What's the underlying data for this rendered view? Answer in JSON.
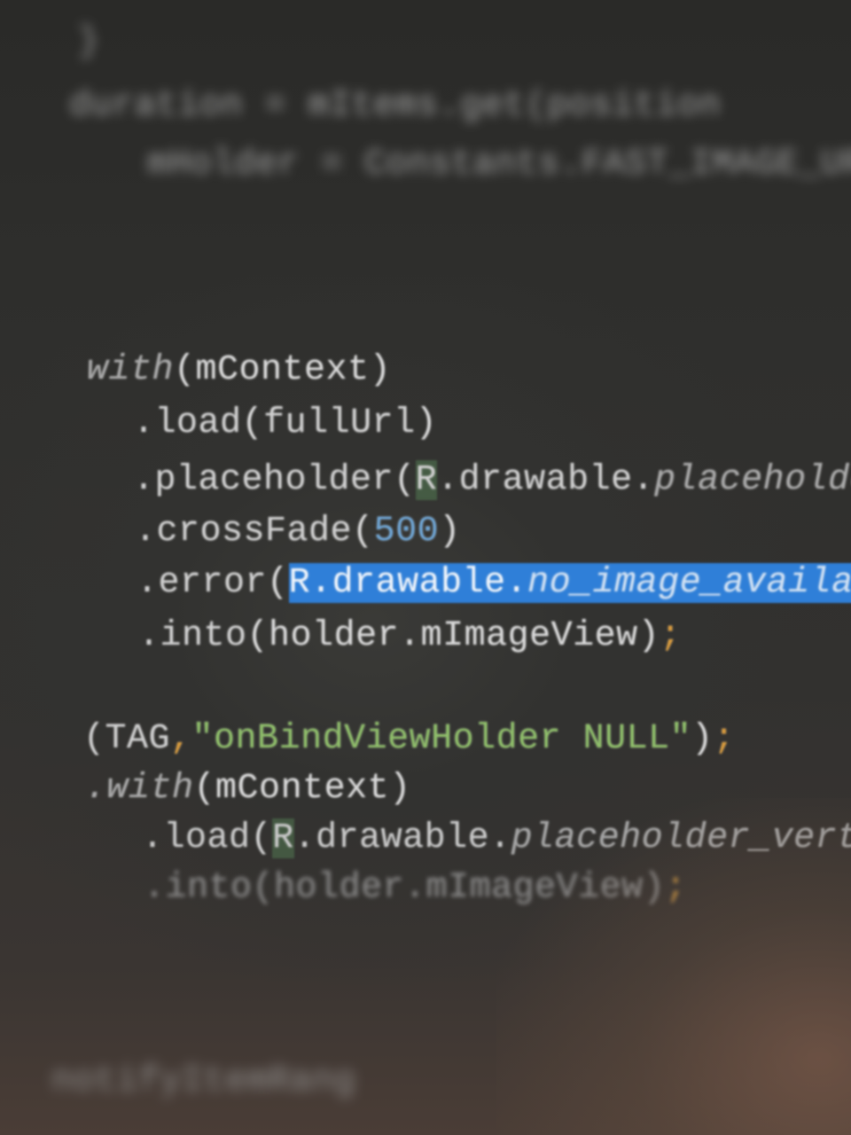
{
  "editor": {
    "blurred_top_lines": [
      "    }",
      "    duration = mItems.get(position",
      "        mHolder = Constants.FAST_IMAGE_URL_PR"
    ],
    "code": {
      "l1": {
        "fn": "with",
        "args": "(mContext)"
      },
      "l2": {
        "method": ".load",
        "open": "(",
        "arg": "fullUrl",
        "close": ")"
      },
      "l3": {
        "method": ".placeholder",
        "open": "(",
        "R": "R",
        "pkg": ".drawable.",
        "field": "placeholder_v"
      },
      "l4": {
        "method": ".crossFade",
        "open": "(",
        "num": "500",
        "close": ")"
      },
      "l5": {
        "method": ".error",
        "open": "(",
        "sel_R": "R",
        "sel_pkg": ".drawable.",
        "sel_field": "no_image_availabl",
        "sel_tail": "e",
        "close": ")"
      },
      "l6": {
        "method": ".into",
        "args": "(holder.mImageView)",
        "semi": ";"
      },
      "l7": {
        "prefix": "(TAG",
        "comma": ",",
        "str": "\"onBindViewHolder NULL\"",
        "close": ")",
        "semi": ";"
      },
      "l8": {
        "fn": ".with",
        "args": "(mContext)"
      },
      "l9": {
        "method": ".load",
        "open": "(",
        "R": "R",
        "pkg": ".drawable.",
        "field": "placeholder_vertical",
        "close": ")"
      },
      "l10": {
        "method": ".into",
        "args": "(holder.mImageView)",
        "semi": ";"
      }
    },
    "blurred_bottom_line": "    notifyItemRang"
  }
}
